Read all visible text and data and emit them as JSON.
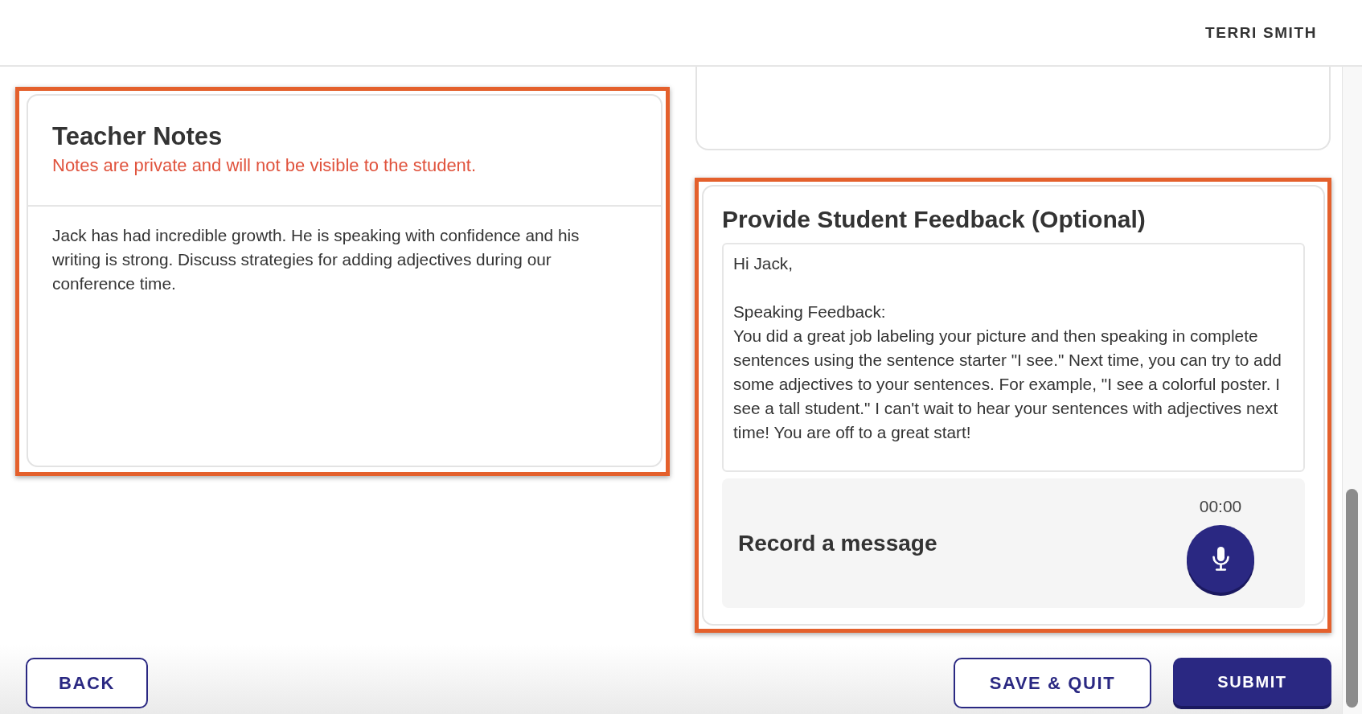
{
  "header": {
    "user_name": "TERRI SMITH"
  },
  "teacher_notes": {
    "highlighted": true,
    "title": "Teacher Notes",
    "subtitle": "Notes are private and will not be visible to the student.",
    "value": "Jack has had incredible growth. He is speaking with confidence and his writing is strong. Discuss strategies for adding adjectives during our conference time."
  },
  "feedback": {
    "highlighted": true,
    "title": "Provide Student Feedback (Optional)",
    "value": "Hi Jack,\n\nSpeaking Feedback:\nYou did a great job labeling your picture and then speaking in complete sentences using the sentence starter \"I see.\" Next time, you can try to add some adjectives to your sentences. For example, \"I see a colorful poster. I see a tall student.\" I can't wait to hear your sentences with adjectives next time! You are off to a great start!",
    "record": {
      "label": "Record a message",
      "timer": "00:00"
    }
  },
  "footer": {
    "left_buttons": [
      {
        "label": "BACK",
        "kind": "outline"
      }
    ],
    "right_buttons": [
      {
        "label": "SAVE & QUIT",
        "kind": "outline"
      },
      {
        "label": "SUBMIT",
        "kind": "primary"
      }
    ]
  }
}
